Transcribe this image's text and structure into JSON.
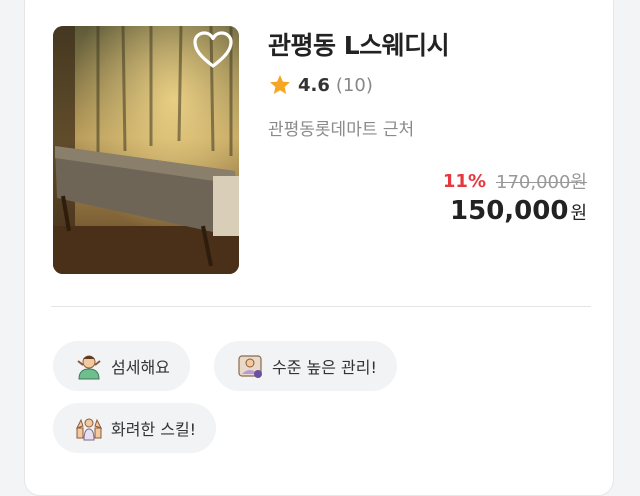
{
  "listing": {
    "title": "관평동 L스웨디시",
    "rating": "4.6",
    "review_count": "(10)",
    "location": "관평동롯데마트 근처",
    "discount": "11%",
    "original_price": "170,000원",
    "price": "150,000",
    "price_unit": "원"
  },
  "tags": [
    {
      "label": "섬세해요",
      "icon": "person-icon"
    },
    {
      "label": "수준 높은 관리!",
      "icon": "spa-treatment-icon"
    },
    {
      "label": "화려한 스킬!",
      "icon": "massage-hands-icon"
    }
  ],
  "colors": {
    "discount": "#e6393f",
    "star": "#f6a623",
    "tag_bg": "#f2f3f5"
  }
}
